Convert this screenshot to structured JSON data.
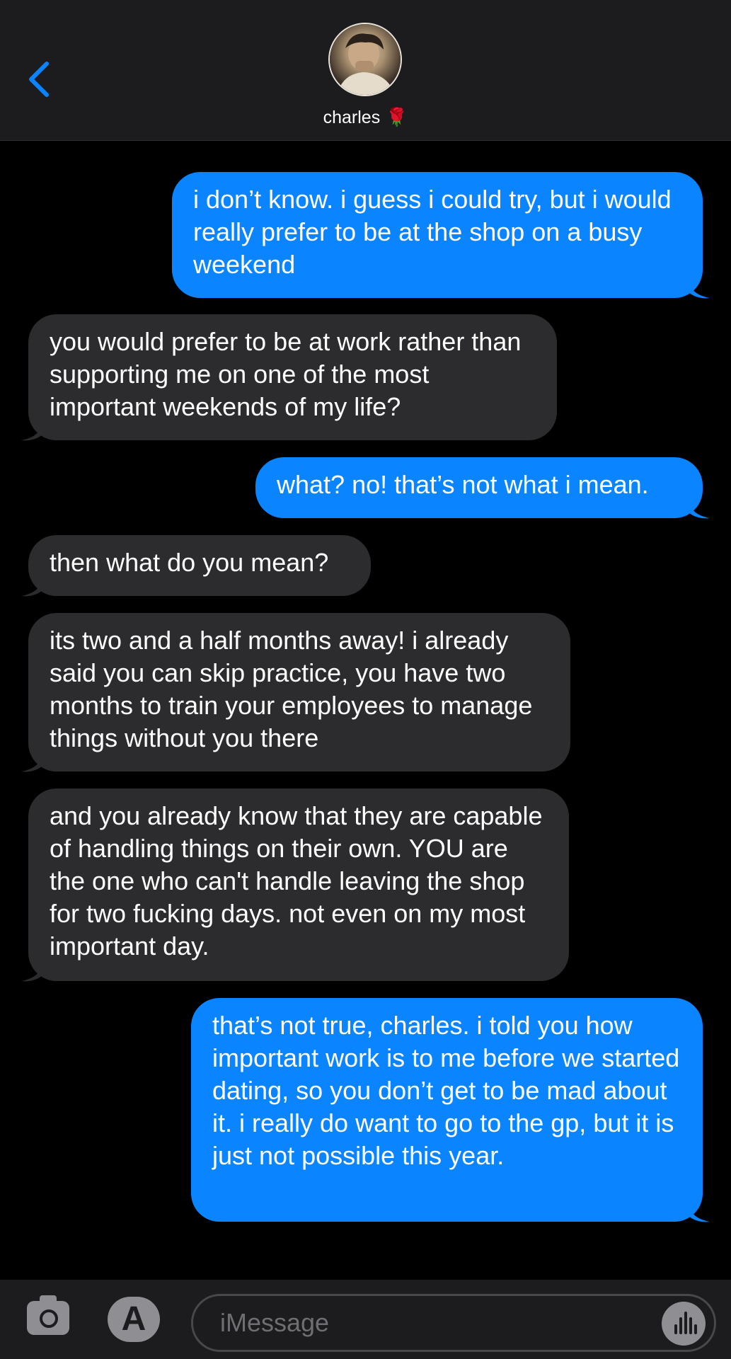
{
  "header": {
    "contact_name": "charles",
    "contact_emoji": "🌹"
  },
  "messages": [
    {
      "side": "sent",
      "text": "i don’t know. i guess i could try, but i would really prefer to be at the shop on a busy weekend"
    },
    {
      "side": "received",
      "text": "you would prefer to be at work rather than supporting me on one of the most important weekends of my life?"
    },
    {
      "side": "sent",
      "text": "what? no! that’s not what i mean."
    },
    {
      "side": "received",
      "text": "then what do you mean?"
    },
    {
      "side": "received",
      "text": "its two and a half months away! i already said you can skip practice, you have two months to train your employees to manage things without you there"
    },
    {
      "side": "received",
      "text": "and you already know that they are capable of handling things on their own. YOU are the one who can't handle leaving the shop for two fucking days. not even on my most important day."
    },
    {
      "side": "sent",
      "text": "that’s not true, charles. i told you how important work is to me before we started dating, so you don’t get to be mad about it. i really do want to go to the gp, but it is just not possible this year."
    }
  ],
  "composer": {
    "placeholder": "iMessage"
  },
  "colors": {
    "sent_bubble": "#0a84ff",
    "received_bubble": "#2c2c2e",
    "accent": "#0a84ff",
    "background": "#000000"
  },
  "icons": [
    "back-chevron-icon",
    "camera-icon",
    "app-store-icon",
    "audio-waveform-icon"
  ]
}
